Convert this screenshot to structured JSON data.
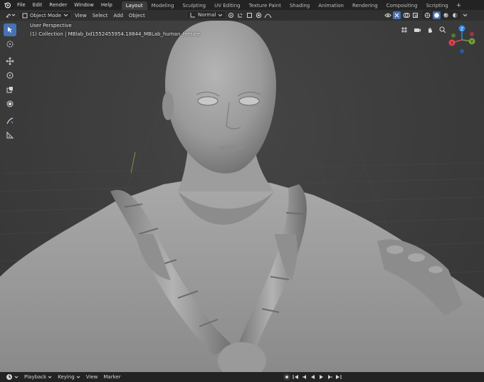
{
  "menubar": {
    "items": [
      "File",
      "Edit",
      "Render",
      "Window",
      "Help"
    ],
    "workspaces": [
      "Layout",
      "Modeling",
      "Sculpting",
      "UV Editing",
      "Texture Paint",
      "Shading",
      "Animation",
      "Rendering",
      "Compositing",
      "Scripting"
    ],
    "active_workspace": "Layout",
    "add_tab": "+"
  },
  "viewport_header": {
    "mode": "Object Mode",
    "menus": [
      "View",
      "Select",
      "Add",
      "Object"
    ],
    "orientation": "Normal"
  },
  "viewport": {
    "view_name": "User Perspective",
    "collection_info": "(1) Collection | MBlab_bd1552455954.18844_MBLab_human_female"
  },
  "gizmo": {
    "z_label": "Z",
    "y_label": "Y",
    "x_label": "X",
    "colors": {
      "x": "#e8434f",
      "y": "#6fa339",
      "z": "#2f87e6"
    }
  },
  "timeline": {
    "items": [
      "Playback",
      "Keying",
      "View",
      "Marker"
    ]
  },
  "colors": {
    "accent": "#4772b3",
    "background": "#393939",
    "header": "#303030",
    "topbar": "#232323"
  }
}
